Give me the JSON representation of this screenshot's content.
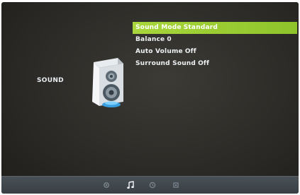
{
  "sidebar": {
    "category_label": "SOUND"
  },
  "menu": {
    "items": [
      {
        "label": "Sound Mode",
        "value": "Standard",
        "selected": true
      },
      {
        "label": "Balance",
        "value": "0",
        "selected": false
      },
      {
        "label": "Auto Volume",
        "value": "Off",
        "selected": false
      },
      {
        "label": "Surround Sound",
        "value": "Off",
        "selected": false
      }
    ]
  },
  "bottom_bar": {
    "tabs": [
      {
        "icon": "picture-icon",
        "active": false
      },
      {
        "icon": "music-note-icon",
        "active": true
      },
      {
        "icon": "clock-icon",
        "active": false
      },
      {
        "icon": "settings-icon",
        "active": false
      }
    ]
  },
  "colors": {
    "selection": "#9ccd33",
    "background": "#2c2b27",
    "text": "#eef1f4",
    "bottom_bar": "#41484d"
  }
}
